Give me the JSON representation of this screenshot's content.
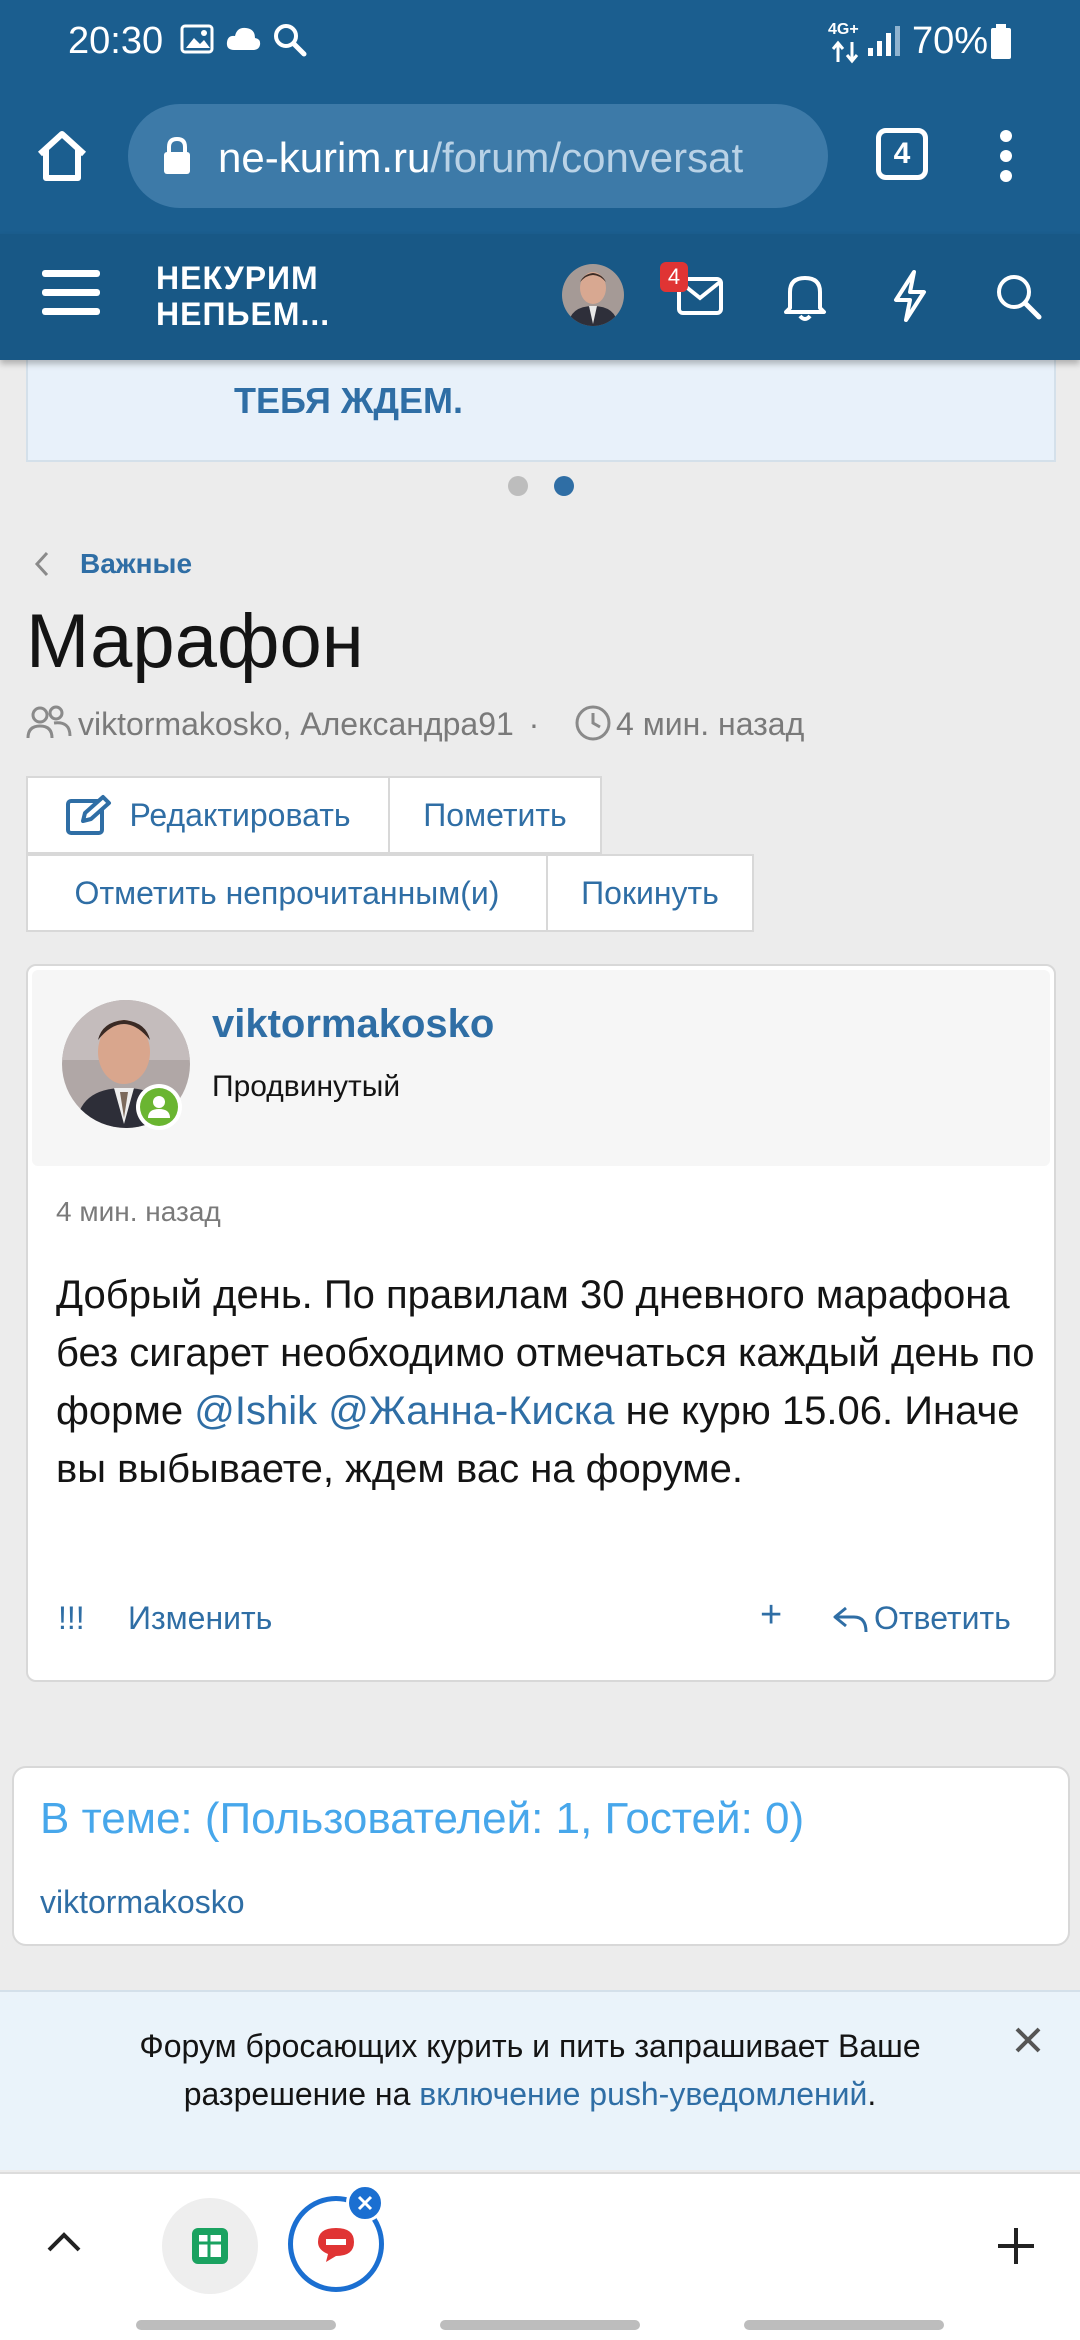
{
  "status_bar": {
    "time": "20:30",
    "network": "4G+",
    "battery": "70%"
  },
  "browser": {
    "url_domain": "ne-kurim.ru",
    "url_path": "/forum/conversat",
    "tab_count": "4"
  },
  "forum_header": {
    "logo_line1": "НЕКУРИМ",
    "logo_line2": "НЕПЬЕМ...",
    "inbox_badge": "4"
  },
  "banner": {
    "text": "ТЕБЯ ЖДЕМ."
  },
  "breadcrumb": "Важные",
  "conversation": {
    "title": "Марафон",
    "participants": "viktormakosko, Александра91",
    "separator": "·",
    "time": "4 мин. назад"
  },
  "actions": {
    "edit": "Редактировать",
    "mark": "Пометить",
    "mark_unread": "Отметить непрочитанным(и)",
    "leave": "Покинуть"
  },
  "post": {
    "author": "viktormakosko",
    "rank": "Продвинутый",
    "time": "4 мин. назад",
    "text_before": "Добрый день. По правилам 30 дневного марафона без сигарет необходимо отмечаться каждый день по форме ",
    "mention1": "@Ishik",
    "mention2": "@Жанна-Киска",
    "text_after": " не курю 15.06. Иначе вы выбываете, ждем вас на форуме.",
    "report_label": "!!!",
    "edit_label": "Изменить",
    "multiquote_label": "+",
    "reply_label": "Ответить"
  },
  "in_thread": {
    "heading": "В теме: (Пользователей: 1, Гостей: 0)",
    "users": "viktormakosko"
  },
  "push_notice": {
    "text": "Форум бросающих курить и пить запрашивает Ваше разрешение на ",
    "link": "включение push-уведомлений",
    "end": "."
  },
  "colors": {
    "header_blue": "#1b5e8f",
    "link_blue": "#2f6ea5",
    "light_blue": "#47a7eb",
    "badge_red": "#e03434",
    "online_green": "#6ab531"
  }
}
